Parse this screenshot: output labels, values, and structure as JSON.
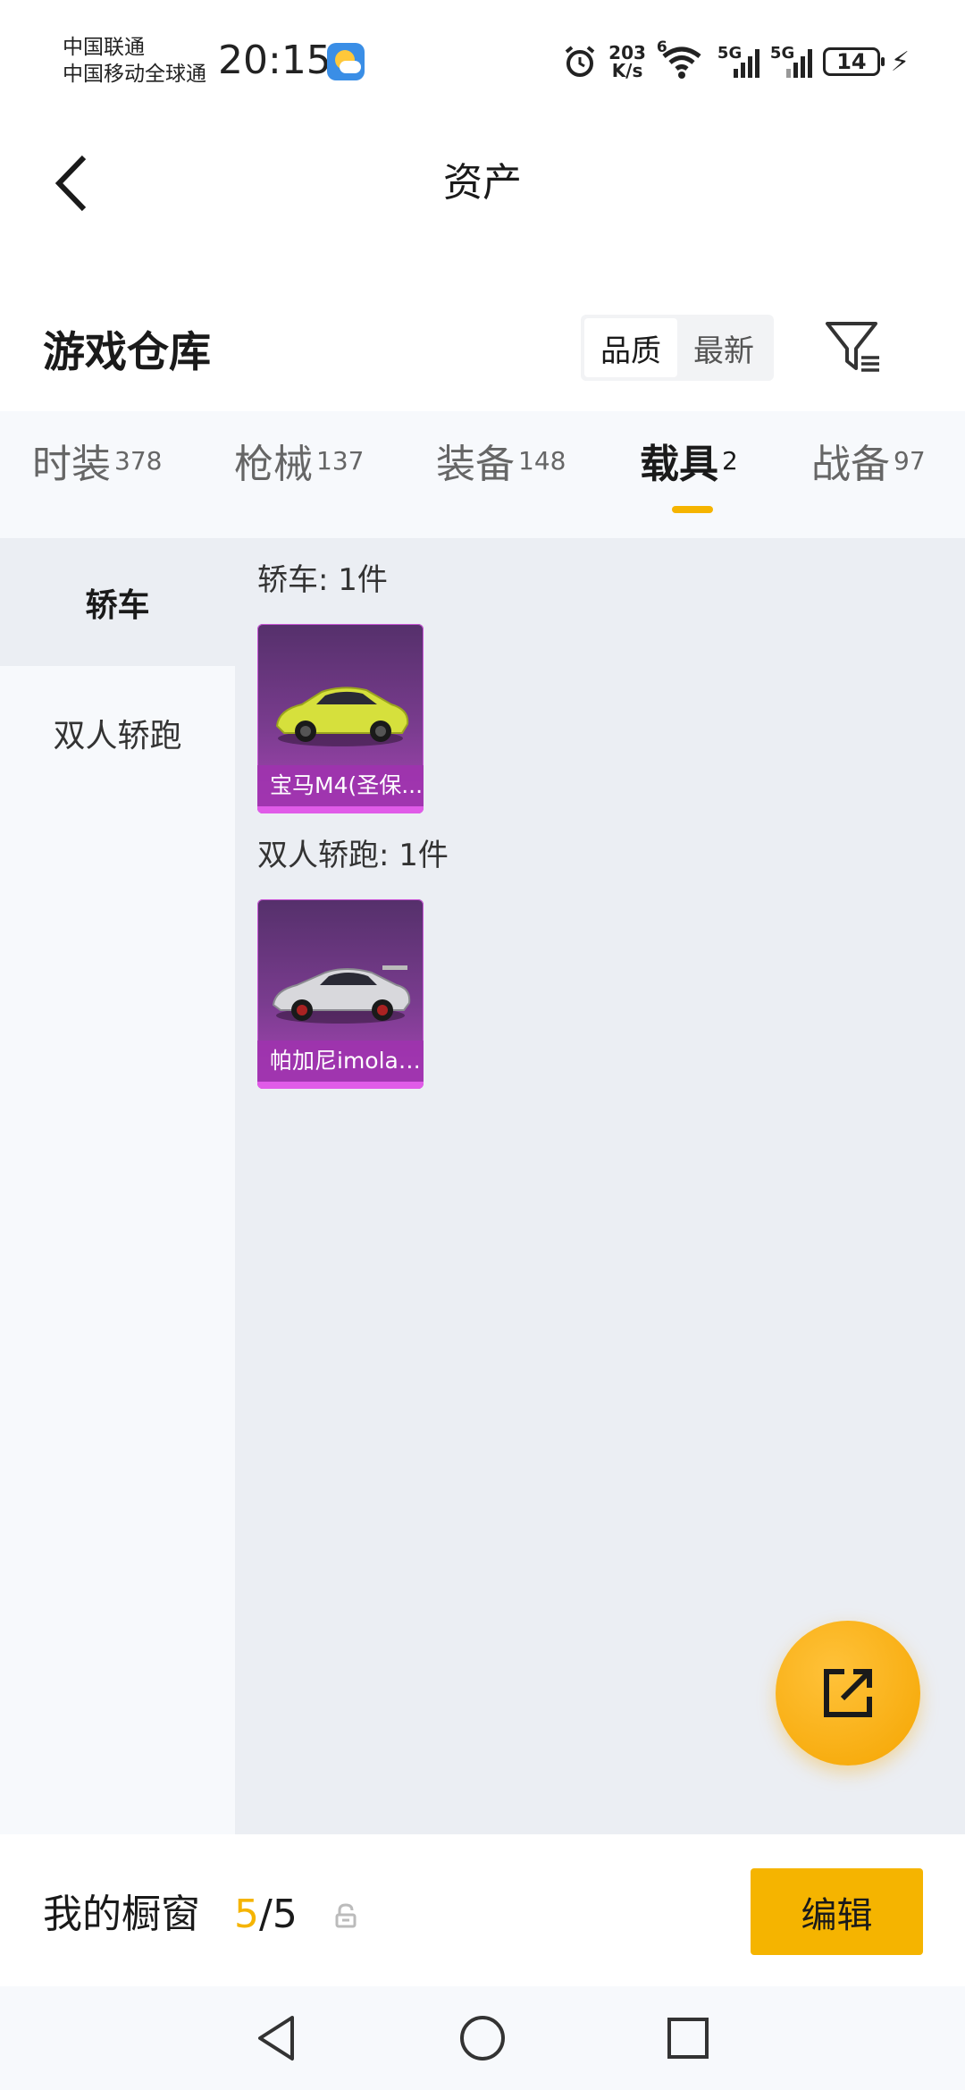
{
  "status_bar": {
    "carrier_1": "中国联通",
    "carrier_2": "中国移动全球通",
    "time": "20:15",
    "net_speed_value": "203",
    "net_speed_unit": "K/s",
    "wifi_tag": "6",
    "signal_1_tag": "5G",
    "signal_2_tag": "5G",
    "battery": "14"
  },
  "header": {
    "title": "资产"
  },
  "warehouse": {
    "title": "游戏仓库",
    "sort_options": [
      "品质",
      "最新"
    ],
    "sort_selected": "品质"
  },
  "tabs": [
    {
      "label": "时装",
      "count": "378"
    },
    {
      "label": "枪械",
      "count": "137"
    },
    {
      "label": "装备",
      "count": "148"
    },
    {
      "label": "载具",
      "count": "2",
      "active": true
    },
    {
      "label": "战备",
      "count": "97"
    }
  ],
  "sidebar": {
    "items": [
      "轿车",
      "双人轿跑"
    ],
    "selected": "轿车"
  },
  "sections": [
    {
      "label": "轿车: 1件",
      "items": [
        {
          "name": "宝马M4(圣保...",
          "color": "#d6e03c"
        }
      ]
    },
    {
      "label": "双人轿跑: 1件",
      "items": [
        {
          "name": "帕加尼imola(...",
          "color": "#d8d8dc"
        }
      ]
    }
  ],
  "showcase": {
    "label": "我的橱窗",
    "current": "5",
    "separator_total": "/5",
    "edit_label": "编辑"
  },
  "colors": {
    "accent": "#f5b400",
    "card_purple": "#7a3c8f"
  }
}
